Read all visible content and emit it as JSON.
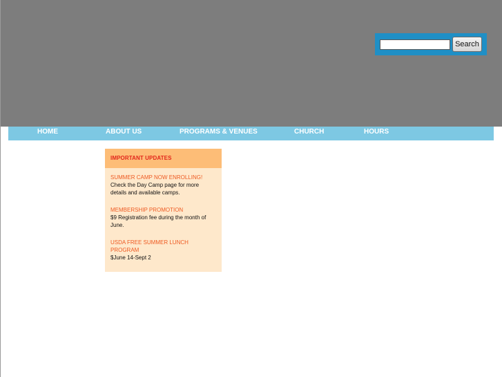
{
  "search": {
    "value": "",
    "placeholder": "",
    "button_label": "Search"
  },
  "nav": {
    "items": [
      {
        "label": "HOME"
      },
      {
        "label": "ABOUT US"
      },
      {
        "label": "PROGRAMS & VENUES"
      },
      {
        "label": "CHURCH"
      },
      {
        "label": "HOURS"
      }
    ]
  },
  "updates": {
    "heading": "IMPORTANT UPDATES",
    "items": [
      {
        "title": "SUMMER CAMP NOW ENROLLING!",
        "text": "Check the Day Camp page for more details and available camps."
      },
      {
        "title": "MEMBERSHIP PROMOTION",
        "text": "$9 Registration fee during the month of June."
      },
      {
        "title": "USDA FREE SUMMER LUNCH PROGRAM",
        "text": "$June 14-Sept 2"
      }
    ]
  },
  "colors": {
    "header_bg": "#7d7d7d",
    "search_bg": "#1f8fc6",
    "nav_bg": "#7dc8e3",
    "updates_header_bg": "#fdbd77",
    "updates_body_bg": "#fee8cb",
    "updates_heading_text": "#e2261c",
    "update_title_text": "#ee5a22"
  }
}
